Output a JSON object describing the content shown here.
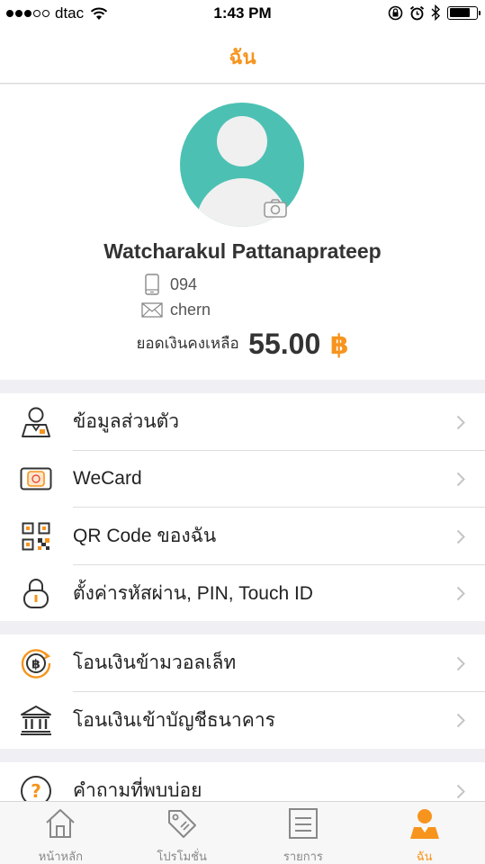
{
  "status_bar": {
    "carrier": "dtac",
    "time": "1:43 PM",
    "signal_bars_filled": 3,
    "signal_bars_total": 5
  },
  "nav": {
    "title": "ฉัน"
  },
  "profile": {
    "name": "Watcharakul Pattanaprateep",
    "phone": "094",
    "email": "chern",
    "balance_label": "ยอดเงินคงเหลือ",
    "balance_amount": "55.00",
    "currency_symbol": "฿"
  },
  "menu": {
    "personal_info": "ข้อมูลส่วนตัว",
    "wecard": "WeCard",
    "qr_code": "QR Code ของฉัน",
    "security": "ตั้งค่ารหัสผ่าน, PIN, Touch ID",
    "transfer_wallet": "โอนเงินข้ามวอลเล็ท",
    "transfer_bank": "โอนเงินเข้าบัญชีธนาคาร",
    "faq": "คำถามที่พบบ่อย"
  },
  "tabs": {
    "home": "หน้าหลัก",
    "promotions": "โปรโมชั่น",
    "transactions": "รายการ",
    "me": "ฉัน"
  },
  "colors": {
    "accent": "#f7941d",
    "avatar_bg": "#4cc1b3",
    "background": "#efeff4"
  }
}
